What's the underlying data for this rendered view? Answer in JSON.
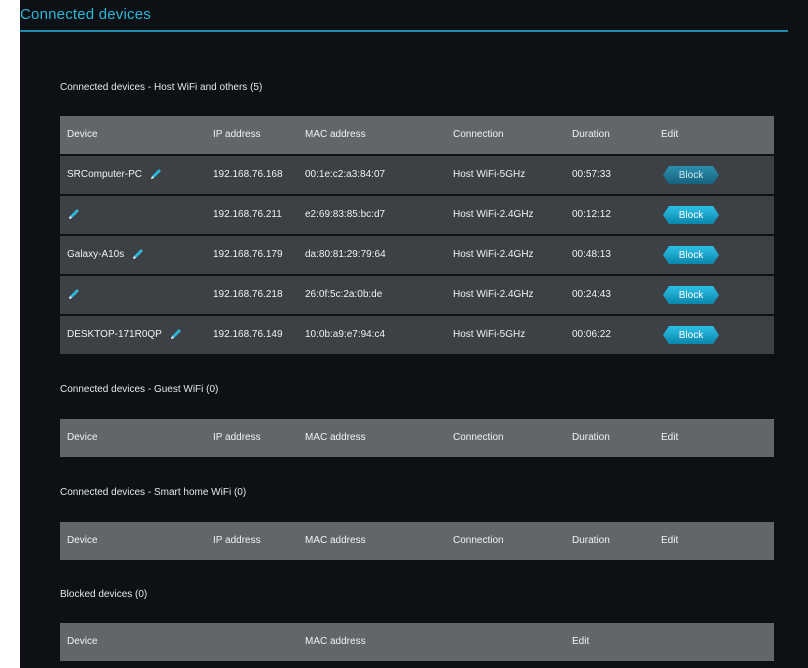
{
  "page": {
    "title": "Connected devices"
  },
  "host_section": {
    "title": "Connected devices - Host WiFi and others (5)",
    "columns": {
      "device": "Device",
      "ip": "IP address",
      "mac": "MAC address",
      "connection": "Connection",
      "duration": "Duration",
      "edit": "Edit"
    },
    "rows": [
      {
        "device": "SRComputer-PC",
        "ip": "192.168.76.168",
        "mac": "00:1e:c2:a3:84:07",
        "connection": "Host WiFi-5GHz",
        "duration": "00:57:33",
        "action": "Block"
      },
      {
        "device": "",
        "ip": "192.168.76.211",
        "mac": "e2:69:83:85:bc:d7",
        "connection": "Host WiFi-2.4GHz",
        "duration": "00:12:12",
        "action": "Block"
      },
      {
        "device": "Galaxy-A10s",
        "ip": "192.168.76.179",
        "mac": "da:80:81:29:79:64",
        "connection": "Host WiFi-2.4GHz",
        "duration": "00:48:13",
        "action": "Block"
      },
      {
        "device": "",
        "ip": "192.168.76.218",
        "mac": "26:0f:5c:2a:0b:de",
        "connection": "Host WiFi-2.4GHz",
        "duration": "00:24:43",
        "action": "Block"
      },
      {
        "device": "DESKTOP-171R0QP",
        "ip": "192.168.76.149",
        "mac": "10:0b:a9:e7:94:c4",
        "connection": "Host WiFi-5GHz",
        "duration": "00:06:22",
        "action": "Block"
      }
    ]
  },
  "guest_section": {
    "title": "Connected devices - Guest WiFi (0)",
    "columns": {
      "device": "Device",
      "ip": "IP address",
      "mac": "MAC address",
      "connection": "Connection",
      "duration": "Duration",
      "edit": "Edit"
    }
  },
  "smart_section": {
    "title": "Connected devices - Smart home WiFi (0)",
    "columns": {
      "device": "Device",
      "ip": "IP address",
      "mac": "MAC address",
      "connection": "Connection",
      "duration": "Duration",
      "edit": "Edit"
    }
  },
  "blocked_section": {
    "title": "Blocked devices (0)",
    "columns": {
      "device": "Device",
      "mac": "MAC address",
      "edit": "Edit"
    }
  },
  "colors": {
    "accent": "#2bb6d6",
    "background": "#0d1014",
    "header_row": "#636669",
    "data_row": "#3d4044"
  },
  "icons": {
    "rename": "pencil-icon"
  }
}
